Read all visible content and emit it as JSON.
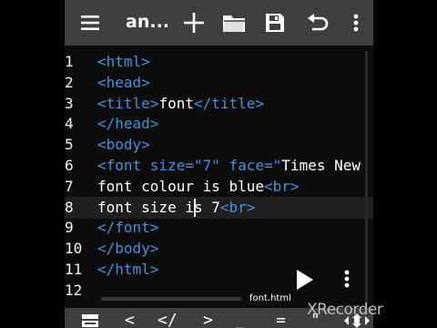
{
  "toolbar": {
    "title": "an...",
    "icons": [
      "menu-icon",
      "add-icon",
      "folder-icon",
      "save-icon",
      "undo-icon",
      "more-vert-icon"
    ]
  },
  "editor": {
    "line_numbers": [
      "1",
      "2",
      "3",
      "4",
      "5",
      "6",
      "7",
      "8",
      "9",
      "10",
      "11",
      "12"
    ],
    "lines": [
      [
        {
          "t": "<html>",
          "c": "tag"
        }
      ],
      [
        {
          "t": "<head>",
          "c": "tag"
        }
      ],
      [
        {
          "t": "<title>",
          "c": "tag"
        },
        {
          "t": "font",
          "c": "txt"
        },
        {
          "t": "</title>",
          "c": "tag"
        }
      ],
      [
        {
          "t": "</head>",
          "c": "tag"
        }
      ],
      [
        {
          "t": "<body>",
          "c": "tag"
        }
      ],
      [
        {
          "t": "<font size=\"7\" face=\"",
          "c": "tag"
        },
        {
          "t": "Times New",
          "c": "txt"
        }
      ],
      [
        {
          "t": "font colour is blue",
          "c": "txt"
        },
        {
          "t": "<br>",
          "c": "tag"
        }
      ],
      [
        {
          "t": "font size is 7",
          "c": "txt"
        },
        {
          "t": "<br>",
          "c": "tag"
        }
      ],
      [
        {
          "t": "</font>",
          "c": "tag"
        }
      ],
      [
        {
          "t": "</body>",
          "c": "tag"
        }
      ],
      [
        {
          "t": "</html>",
          "c": "tag"
        }
      ],
      []
    ],
    "current_line": 8,
    "filename": "font.html"
  },
  "bottom_keys": [
    "<",
    "</",
    ">",
    "=",
    "\""
  ],
  "watermark": "XRecorder",
  "colors": {
    "toolbar_bg": "#3f3f3f",
    "editor_bg": "#0d0d0d",
    "tag": "#4a8fd8",
    "text": "#ffffff"
  }
}
